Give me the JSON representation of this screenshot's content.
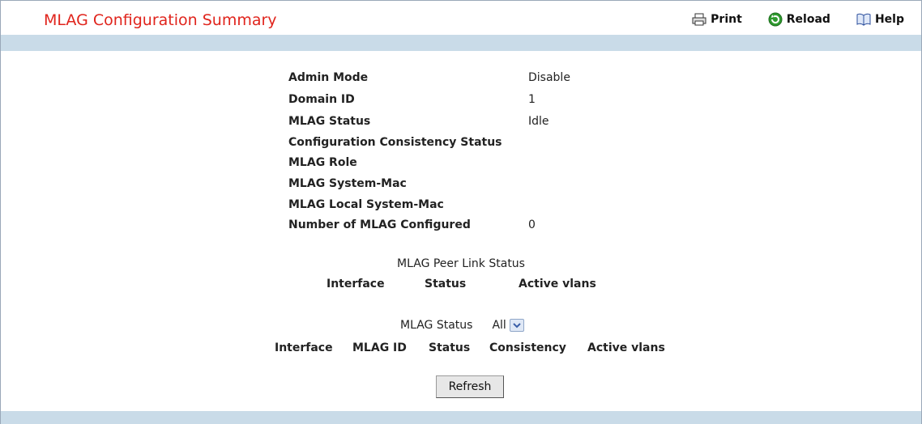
{
  "page": {
    "title": "MLAG Configuration Summary"
  },
  "toolbar": {
    "print": "Print",
    "reload": "Reload",
    "help": "Help"
  },
  "summary": [
    {
      "label": "Admin Mode",
      "value": "Disable"
    },
    {
      "label": "Domain ID",
      "value": "1"
    },
    {
      "label": "MLAG Status",
      "value": "Idle"
    },
    {
      "label": "Configuration Consistency Status",
      "value": ""
    },
    {
      "label": "MLAG Role",
      "value": ""
    },
    {
      "label": "MLAG System-Mac",
      "value": ""
    },
    {
      "label": "MLAG Local System-Mac",
      "value": ""
    },
    {
      "label": "Number of MLAG Configured",
      "value": "0"
    }
  ],
  "peer_link": {
    "title": "MLAG Peer Link Status",
    "columns": [
      "Interface",
      "Status",
      "Active vlans"
    ]
  },
  "mlag_status": {
    "label": "MLAG Status",
    "selected": "All",
    "columns": [
      "Interface",
      "MLAG ID",
      "Status",
      "Consistency",
      "Active vlans"
    ]
  },
  "refresh_label": "Refresh",
  "colors": {
    "title": "#e0241c",
    "bar": "#c9dbe8"
  }
}
